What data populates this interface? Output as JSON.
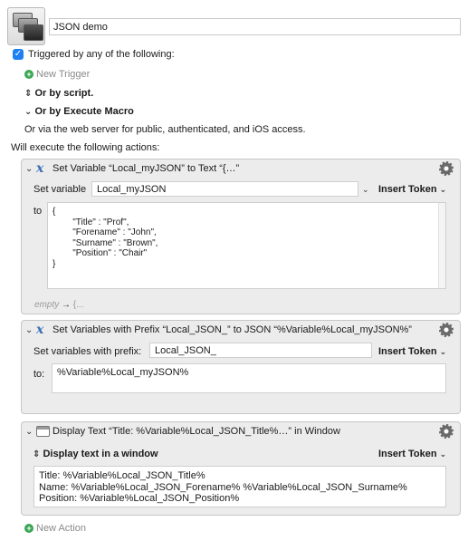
{
  "macro": {
    "name": "JSON demo"
  },
  "triggers": {
    "checkbox_label": "Triggered by any of the following:",
    "new_trigger": "New Trigger",
    "or_by_script": "Or by script.",
    "or_by_execute_macro": "Or by Execute Macro",
    "web_server_text": "Or via the web server for public, authenticated, and iOS access."
  },
  "actions_header": "Will execute the following actions:",
  "actions": [
    {
      "title": "Set Variable “Local_myJSON” to Text “{…”",
      "set_variable_label": "Set variable",
      "variable_name": "Local_myJSON",
      "insert_token": "Insert Token",
      "to_label": "to",
      "text_value": "{\n        \"Title\" : \"Prof\",\n        \"Forename\" : \"John\",\n        \"Surname\" : \"Brown\",\n        \"Position\" : \"Chair\"\n}",
      "empty_hint": "empty",
      "empty_arrow": "→",
      "empty_tail": "{..."
    },
    {
      "title": "Set Variables with Prefix “Local_JSON_” to JSON “%Variable%Local_myJSON%”",
      "prefix_label": "Set variables with prefix:",
      "prefix_value": "Local_JSON_",
      "insert_token": "Insert Token",
      "to_label": "to:",
      "json_value": "%Variable%Local_myJSON%"
    },
    {
      "title": "Display Text “Title: %Variable%Local_JSON_Title%…” in Window",
      "mode_label": "Display text in a window",
      "insert_token": "Insert Token",
      "text_value": "Title: %Variable%Local_JSON_Title%\nName: %Variable%Local_JSON_Forename% %Variable%Local_JSON_Surname%\nPosition: %Variable%Local_JSON_Position%"
    }
  ],
  "new_action": "New Action",
  "icons": {
    "collapse": "chevron-down-icon",
    "variable": "x-variable-icon",
    "gear": "gear-icon",
    "window": "window-icon",
    "add": "plus-circle-icon"
  },
  "colors": {
    "accent": "#1e7ff2",
    "add_green": "#3aa655",
    "variable_blue": "#3b6fb6"
  }
}
